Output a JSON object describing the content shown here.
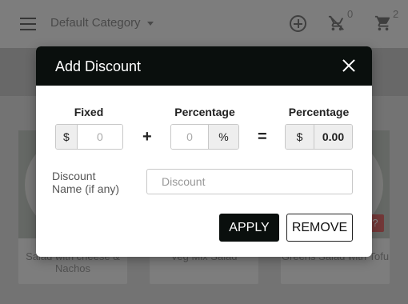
{
  "topbar": {
    "category_label": "Default Category",
    "wishlist_count": "0",
    "cart_count": "2"
  },
  "products": [
    {
      "name": "Salad with cheese & Nachos"
    },
    {
      "name": "Veg Mix Salad"
    },
    {
      "name": "Greens Salad with Tofu"
    }
  ],
  "product_badge": "?",
  "modal": {
    "title": "Add Discount",
    "fixed": {
      "label": "Fixed",
      "prefix": "$",
      "value": "",
      "placeholder": "0"
    },
    "plus_symbol": "+",
    "percentage": {
      "label": "Percentage",
      "value": "",
      "placeholder": "0",
      "suffix": "%"
    },
    "equals_symbol": "=",
    "result": {
      "label": "Percentage",
      "prefix": "$",
      "value": "0.00"
    },
    "discount_name": {
      "label_line1": "Discount",
      "label_line2": "Name (if any)",
      "value": "",
      "placeholder": "Discount"
    },
    "apply_label": "APPLY",
    "remove_label": "REMOVE"
  },
  "colors": {
    "header_bg": "#0a0f0d",
    "accent_dark": "#0a0f0d",
    "badge": "#d96a6a"
  },
  "icons": {
    "menu": "hamburger-icon",
    "add": "plus-circle-icon",
    "wishlist": "cart-remove-icon",
    "cart": "cart-icon",
    "close": "close-icon"
  }
}
